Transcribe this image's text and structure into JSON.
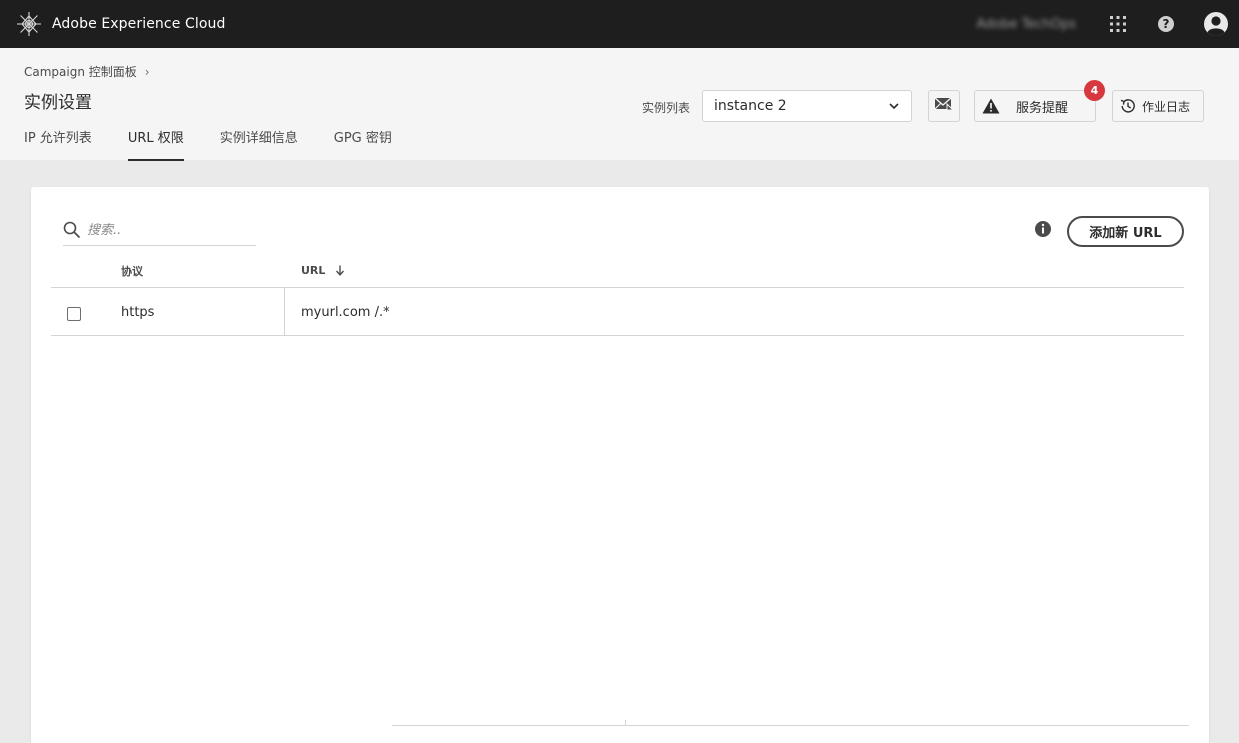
{
  "shell": {
    "brand": "Adobe Experience Cloud",
    "org_name": "Adobe TechOps",
    "icons": {
      "logo": "adobe-experience-cloud-logo",
      "apps": "apps-grid-icon",
      "help": "help-icon",
      "avatar": "user-avatar-icon"
    }
  },
  "header": {
    "breadcrumb": "Campaign 控制面板",
    "breadcrumb_separator": "›",
    "title": "实例设置",
    "tabs": [
      {
        "label": "IP 允许列表",
        "active": false
      },
      {
        "label": "URL 权限",
        "active": true
      },
      {
        "label": "实例详细信息",
        "active": false
      },
      {
        "label": "GPG 密钥",
        "active": false
      }
    ],
    "instance_label": "实例列表",
    "instance_selected": "instance 2",
    "alerts_label": "服务提醒",
    "alerts_count": "4",
    "joblog_label": "作业日志"
  },
  "content": {
    "search_placeholder": "搜索..",
    "add_button": "添加新 URL",
    "columns": {
      "protocol": "协议",
      "url": "URL"
    },
    "sort": {
      "column": "url",
      "direction": "descending"
    },
    "rows": [
      {
        "protocol": "https",
        "url": "myurl.com /.*",
        "checked": false
      }
    ]
  },
  "colors": {
    "topbar": "#1e1e1e",
    "header_bg": "#f5f5f5",
    "page_bg": "#eaeaea",
    "badge": "#d7373f",
    "text": "#2c2c2c"
  }
}
